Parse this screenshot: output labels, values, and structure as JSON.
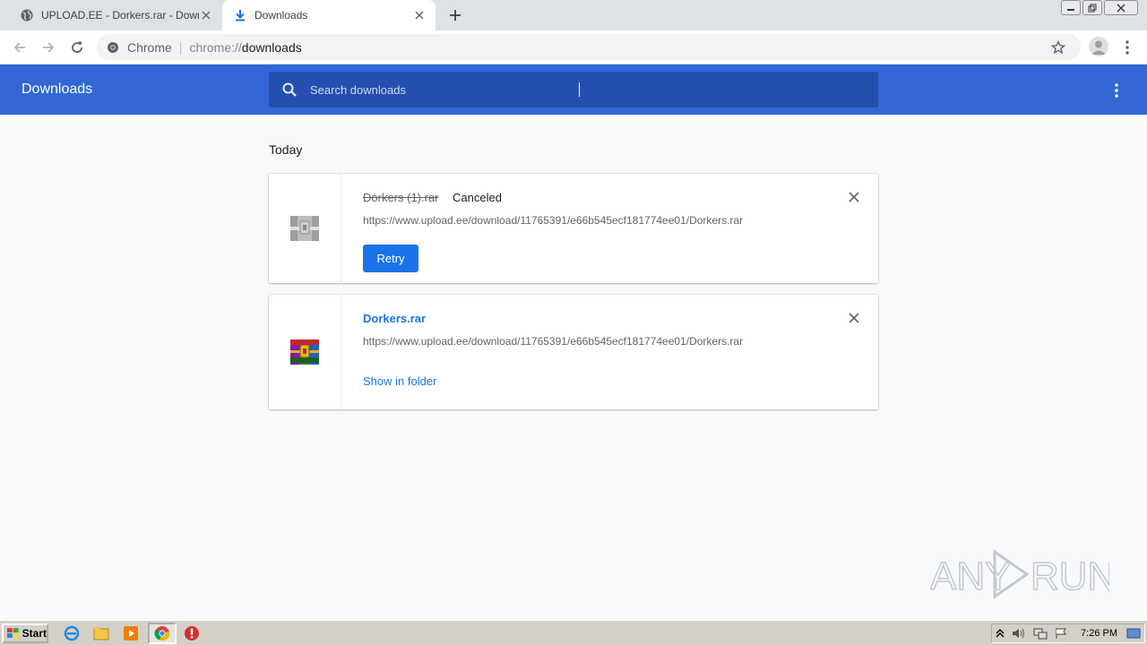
{
  "tabs": [
    {
      "title": "UPLOAD.EE - Dorkers.rar - Download",
      "icon": "globe-icon"
    },
    {
      "title": "Downloads",
      "icon": "download-icon"
    }
  ],
  "omnibox": {
    "chip": "Chrome",
    "scheme": "chrome://",
    "host": "downloads"
  },
  "header": {
    "title": "Downloads",
    "search_placeholder": "Search downloads"
  },
  "section": {
    "label": "Today"
  },
  "downloads": [
    {
      "file_name": "Dorkers (1).rar",
      "status": "Canceled",
      "url": "https://www.upload.ee/download/11765391/e66b545ecf181774ee01/Dorkers.rar",
      "action": "Retry"
    },
    {
      "file_name": "Dorkers.rar",
      "url": "https://www.upload.ee/download/11765391/e66b545ecf181774ee01/Dorkers.rar",
      "action": "Show in folder"
    }
  ],
  "taskbar": {
    "start_label": "Start",
    "clock": "7:26 PM"
  },
  "watermark": {
    "text": "ANY RUN"
  },
  "colors": {
    "header_blue": "#3367d6",
    "search_blue": "#254fae",
    "accent": "#1a73e8"
  }
}
